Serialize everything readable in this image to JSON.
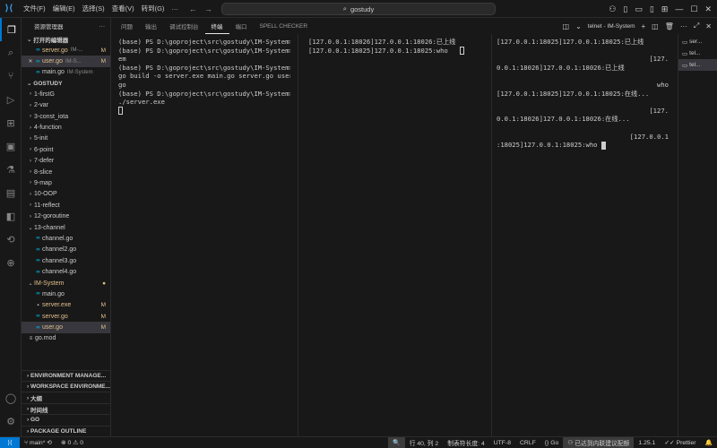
{
  "titlebar": {
    "menu": [
      "文件(F)",
      "编辑(E)",
      "选择(S)",
      "查看(V)",
      "转到(G)",
      "…"
    ],
    "search_text": "gostudy"
  },
  "sidebar": {
    "header": "资源管理器",
    "open_editors_title": "打开的编辑器",
    "open_editors": [
      {
        "name": "server.go",
        "path": "IM-...",
        "badge": "M",
        "closable": false
      },
      {
        "name": "user.go",
        "path": "IM-S...",
        "badge": "M",
        "closable": true
      },
      {
        "name": "main.go",
        "path": "IM-System",
        "badge": "",
        "closable": false
      }
    ],
    "workspace_title": "GOSTUDY",
    "tree": [
      {
        "label": "1-firstG",
        "type": "folder"
      },
      {
        "label": "2-var",
        "type": "folder"
      },
      {
        "label": "3-const_iota",
        "type": "folder"
      },
      {
        "label": "4-function",
        "type": "folder"
      },
      {
        "label": "5-init",
        "type": "folder"
      },
      {
        "label": "6-point",
        "type": "folder"
      },
      {
        "label": "7-defer",
        "type": "folder"
      },
      {
        "label": "8-slice",
        "type": "folder"
      },
      {
        "label": "9-map",
        "type": "folder"
      },
      {
        "label": "10-OOP",
        "type": "folder"
      },
      {
        "label": "11-reflect",
        "type": "folder"
      },
      {
        "label": "12-goroutine",
        "type": "folder"
      },
      {
        "label": "13-channel",
        "type": "folder-open"
      },
      {
        "label": "channel.go",
        "type": "file"
      },
      {
        "label": "channel2.go",
        "type": "file"
      },
      {
        "label": "channel3.go",
        "type": "file"
      },
      {
        "label": "channel4.go",
        "type": "file"
      },
      {
        "label": "IM-System",
        "type": "folder-open-mod"
      },
      {
        "label": "main.go",
        "type": "file"
      },
      {
        "label": "server.exe",
        "type": "exe-mod",
        "badge": "M"
      },
      {
        "label": "server.go",
        "type": "file-mod",
        "badge": "M"
      },
      {
        "label": "user.go",
        "type": "file-mod-sel",
        "badge": "M"
      },
      {
        "label": "go.mod",
        "type": "mod"
      }
    ],
    "outline_sections": [
      "ENVIRONMENT MANAGE...",
      "WORKSPACE ENVIRONME...",
      "大纲",
      "时间线",
      "GO",
      "PACKAGE OUTLINE"
    ]
  },
  "panel": {
    "tabs": [
      "问题",
      "输出",
      "调试控制台",
      "终端",
      "端口",
      "SPELL CHECKER"
    ],
    "active_tab": "终端",
    "terminal_label": "telnet - IM-System",
    "terminal1": [
      "(base) PS D:\\goproject\\src\\gostudy\\IM-System>",
      "(base) PS D:\\goproject\\src\\gostudy\\IM-System> cd IM-Syst",
      "em",
      "(base) PS D:\\goproject\\src\\gostudy\\IM-System>",
      "go build -o server.exe main.go server.go user.",
      "go",
      "(base) PS D:\\goproject\\src\\gostudy\\IM-System>",
      "./server.exe"
    ],
    "terminal2": [
      "[127.0.0.1:18026]127.0.0.1:18026:已上线",
      "[127.0.0.1:18025]127.0.0.1:18025:who"
    ],
    "terminal3": [
      {
        "text": "[127.0.0.1:18025]127.0.0.1:18025:已上线",
        "align": "left"
      },
      {
        "text": "[127.",
        "align": "right"
      },
      {
        "text": "0.0.1:18026]127.0.0.1:18026:已上线",
        "align": "left"
      },
      {
        "text": "who",
        "align": "right"
      },
      {
        "text": "[127.0.0.1:18025]127.0.0.1:18025:在线...",
        "align": "left"
      },
      {
        "text": "[127.",
        "align": "right"
      },
      {
        "text": "0.0.1:18026]127.0.0.1:18026:在线...",
        "align": "left"
      },
      {
        "text": "[127.0.0.1",
        "align": "right"
      },
      {
        "text": ":18025]127.0.0.1:18025:who",
        "align": "left"
      }
    ],
    "terminal_list": [
      "ser...",
      "tel...",
      "tel..."
    ]
  },
  "statusbar": {
    "branch": "main*",
    "errors": "0",
    "warnings": "0",
    "position": "行 40, 列 2",
    "tab_size": "制表符长度: 4",
    "encoding": "UTF-8",
    "eol": "CRLF",
    "language": "Go",
    "connection": "已达到内联建议配额",
    "version": "1.25.1",
    "formatter": "Prettier"
  }
}
